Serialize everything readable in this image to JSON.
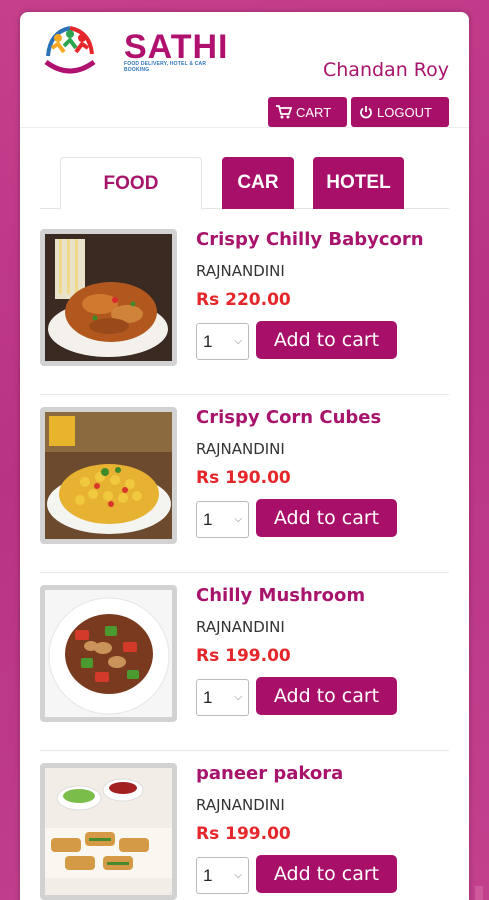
{
  "header": {
    "brand": "SATHI",
    "tagline": "FOOD DELIVERY, HOTEL & CAR BOOKING",
    "user_name": "Chandan Roy",
    "cart_label": "CART",
    "logout_label": "LOGOUT"
  },
  "tabs": [
    {
      "label": "FOOD",
      "active": true
    },
    {
      "label": "CAR",
      "active": false
    },
    {
      "label": "HOTEL",
      "active": false
    }
  ],
  "items": [
    {
      "name": "Crispy Chilly Babycorn",
      "restaurant": "RAJNANDINI",
      "price": "Rs 220.00",
      "qty": "1",
      "button": "Add to cart"
    },
    {
      "name": "Crispy Corn Cubes",
      "restaurant": "RAJNANDINI",
      "price": "Rs 190.00",
      "qty": "1",
      "button": "Add to cart"
    },
    {
      "name": "Chilly Mushroom",
      "restaurant": "RAJNANDINI",
      "price": "Rs 199.00",
      "qty": "1",
      "button": "Add to cart"
    },
    {
      "name": "paneer pakora",
      "restaurant": "RAJNANDINI",
      "price": "Rs 199.00",
      "qty": "1",
      "button": "Add to cart"
    }
  ],
  "colors": {
    "accent": "#a80f68",
    "price": "#e5262a",
    "background": "#c03a89"
  }
}
